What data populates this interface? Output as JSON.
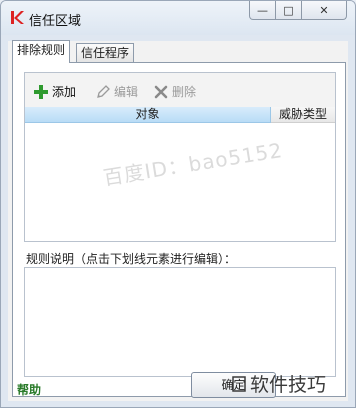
{
  "window": {
    "title": "信任区域",
    "controls": {
      "minimize": "—",
      "maximize": "□",
      "close": "✕"
    }
  },
  "tabs": [
    {
      "label": "排除规则",
      "active": true
    },
    {
      "label": "信任程序",
      "active": false
    }
  ],
  "toolbar": {
    "add_label": "添加",
    "edit_label": "编辑",
    "delete_label": "删除"
  },
  "table": {
    "columns": [
      "对象",
      "威胁类型"
    ],
    "rows": []
  },
  "description": {
    "label": "规则说明（点击下划线元素进行编辑）：",
    "value": ""
  },
  "footer": {
    "help_label": "帮助",
    "ok_label": "确定"
  },
  "overlays": {
    "watermark": "百度ID：bao5152",
    "brand": "软件技巧"
  },
  "colors": {
    "accent": "#b9dcf6",
    "help_link": "#2a7b2a",
    "add_icon": "#2e9a2e"
  }
}
